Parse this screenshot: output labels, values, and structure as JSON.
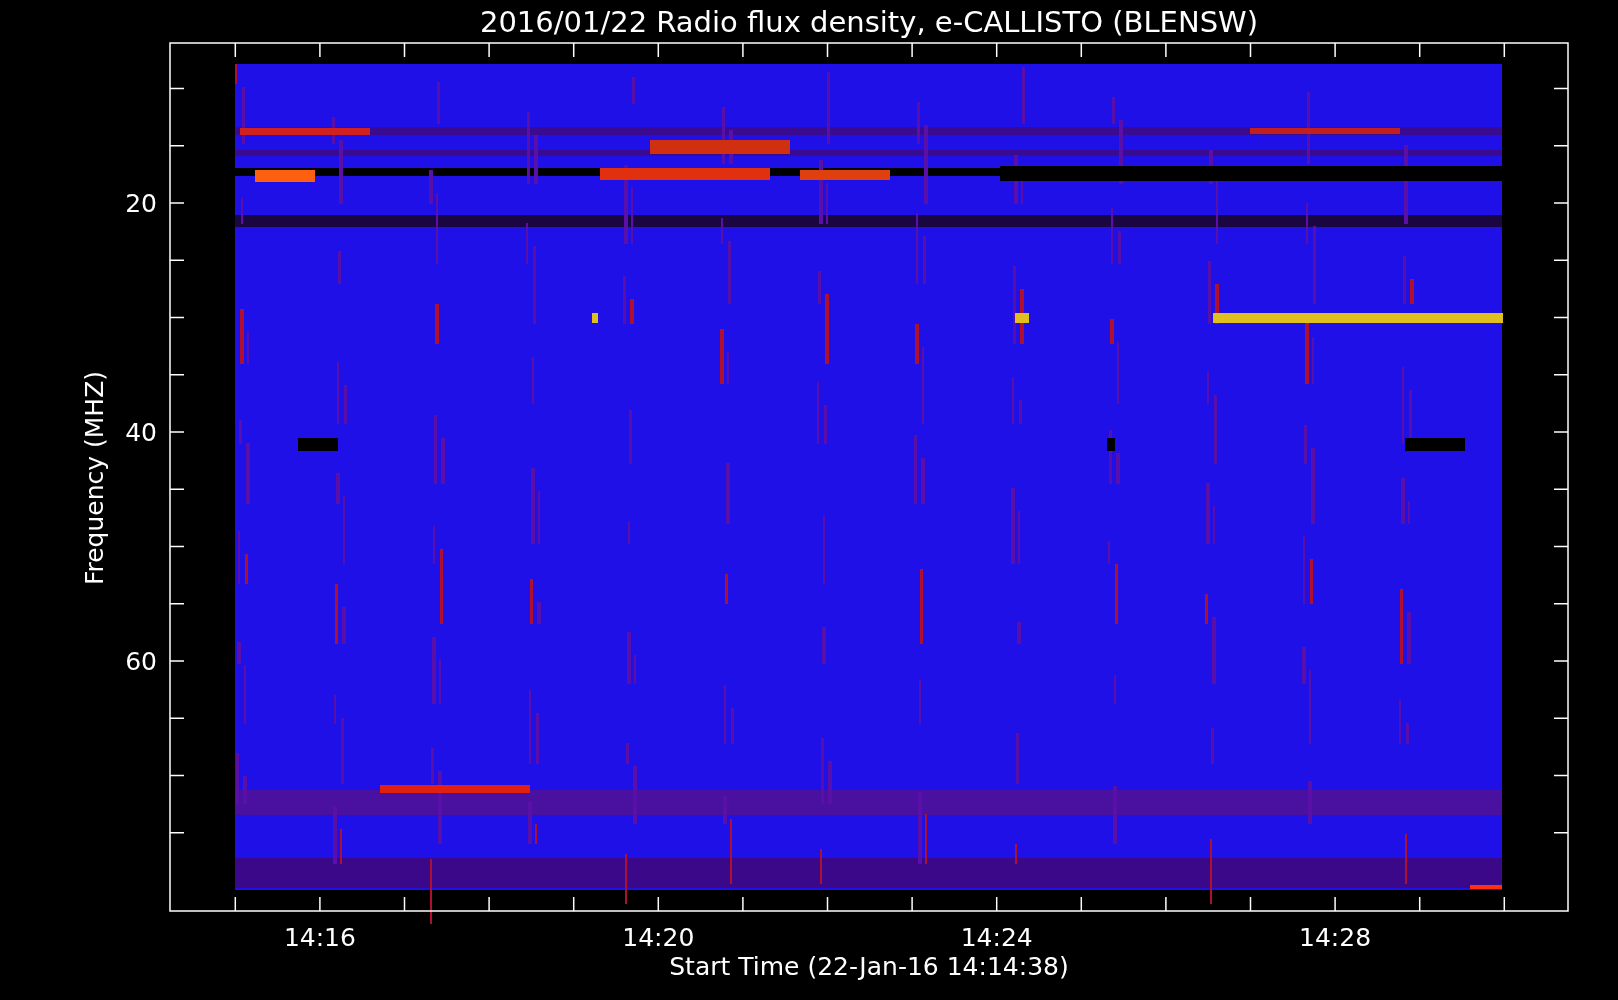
{
  "title": "2016/01/22  Radio flux density, e-CALLISTO (BLENSW)",
  "plot": {
    "ylabel": "Frequency (MHZ)",
    "xlabel": "Start Time (22-Jan-16 14:14:38)",
    "yticks": [
      "20",
      "40",
      "60"
    ],
    "xticks": [
      "14:16",
      "14:20",
      "14:24",
      "14:28"
    ]
  }
}
